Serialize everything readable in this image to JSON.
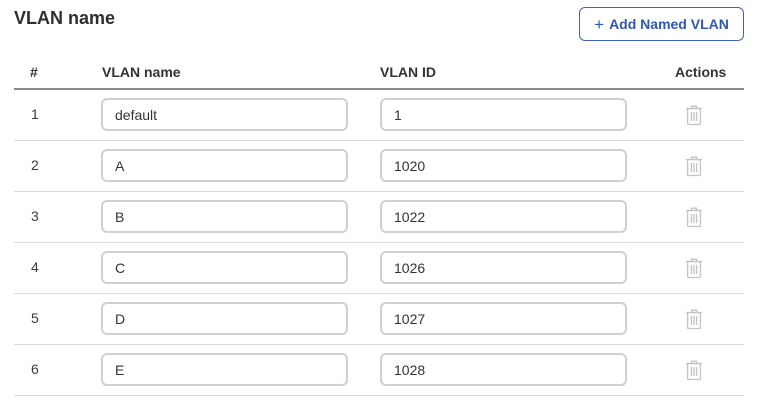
{
  "section": {
    "title": "VLAN name",
    "add_button_label": "Add Named VLAN"
  },
  "table": {
    "headers": {
      "num": "#",
      "name": "VLAN name",
      "id": "VLAN ID",
      "actions": "Actions"
    },
    "rows": [
      {
        "num": "1",
        "name": "default",
        "vlan_id": "1"
      },
      {
        "num": "2",
        "name": "A",
        "vlan_id": "1020"
      },
      {
        "num": "3",
        "name": "B",
        "vlan_id": "1022"
      },
      {
        "num": "4",
        "name": "C",
        "vlan_id": "1026"
      },
      {
        "num": "5",
        "name": "D",
        "vlan_id": "1027"
      },
      {
        "num": "6",
        "name": "E",
        "vlan_id": "1028"
      }
    ]
  },
  "icons": {
    "add": "plus-icon",
    "delete": "trash-icon"
  },
  "colors": {
    "accent": "#2f57b3",
    "icon_disabled": "#c4c4c4",
    "input_border": "#d0d0d0"
  }
}
